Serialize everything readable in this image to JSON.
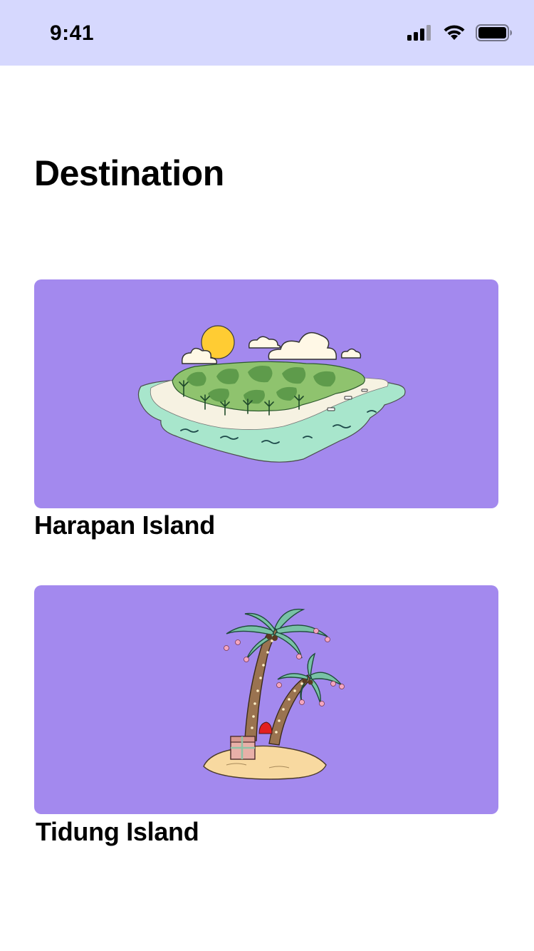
{
  "status_bar": {
    "time": "9:41",
    "icons": [
      "cellular-signal-icon",
      "wifi-icon",
      "battery-icon"
    ],
    "background": "#D6D8FE"
  },
  "page": {
    "title": "Destination"
  },
  "destinations": [
    {
      "name": "Harapan Island",
      "illustration": "island-illustration",
      "card_color": "#A389EE"
    },
    {
      "name": "Tidung Island",
      "illustration": "palm-trees-illustration",
      "card_color": "#A389EE"
    }
  ]
}
